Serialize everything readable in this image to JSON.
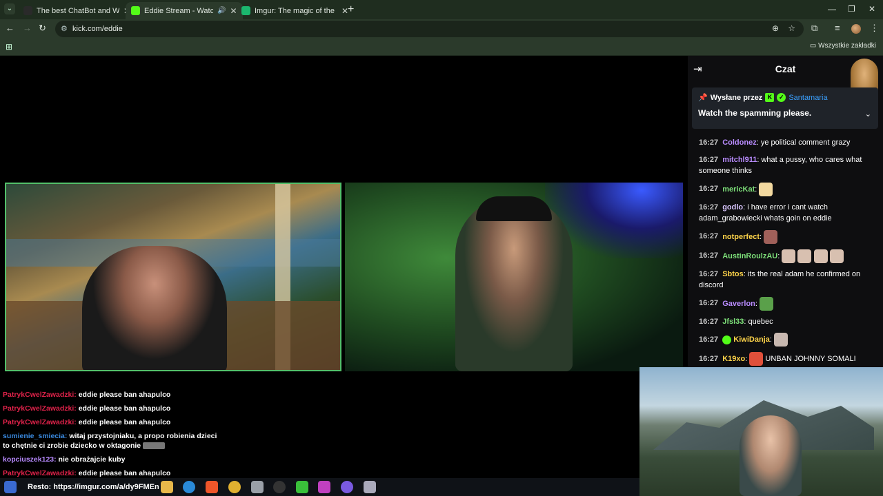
{
  "browser": {
    "tabs": [
      {
        "title": "The best ChatBot and Widgets",
        "active": false
      },
      {
        "title": "Eddie Stream - Watch Live",
        "active": true
      },
      {
        "title": "Imgur: The magic of the Internet",
        "active": false
      }
    ],
    "url": "kick.com/eddie",
    "bookmarks_all": "Wszystkie zakładki"
  },
  "overlay_chat": [
    {
      "user": "PatrykCwelZawadzki:",
      "text": "eddie please ban ahapulco",
      "color": "red"
    },
    {
      "user": "PatrykCwelZawadzki:",
      "text": "eddie please ban ahapulco",
      "color": "red"
    },
    {
      "user": "PatrykCwelZawadzki:",
      "text": "eddie please ban ahapulco",
      "color": "red"
    },
    {
      "user": "sumienie_smiecia:",
      "text": "witaj przystojniaku, a propo robienia dzieci",
      "text2": "to chętnie ci zrobie dziecko w oktagonie",
      "color": "blue"
    },
    {
      "user": "kopciuszek123:",
      "text": "nie obrażajcie kuby",
      "color": "purple"
    },
    {
      "user": "PatrykCwelZawadzki:",
      "text": "eddie please ban ahapulco",
      "color": "red"
    }
  ],
  "chat": {
    "title": "Czat",
    "pinned": {
      "label": "Wysłane przez",
      "user": "Santamaria",
      "text": "Watch the spamming please."
    },
    "messages": [
      {
        "time": "16:27",
        "user": "Coldonez",
        "text": "ye political comment grazy",
        "color": "#b98cff"
      },
      {
        "time": "16:27",
        "user": "mitchl911",
        "text": "what a pussy, who cares what someone thinks",
        "color": "#b98cff"
      },
      {
        "time": "16:27",
        "user": "mericKat",
        "text": "",
        "color": "#7ee07a"
      },
      {
        "time": "16:27",
        "user": "godlo",
        "text": "i have error i cant watch adam_grabowiecki whats goin on eddie",
        "color": "#d9c6ff"
      },
      {
        "time": "16:27",
        "user": "notperfect",
        "text": "",
        "color": "#ffd54a"
      },
      {
        "time": "16:27",
        "user": "AustinRoulzAU",
        "text": "",
        "color": "#7ee07a"
      },
      {
        "time": "16:27",
        "user": "Sbtos",
        "text": "its the real adam he confirmed on discord",
        "color": "#ffd54a"
      },
      {
        "time": "16:27",
        "user": "Gaverlon",
        "text": "",
        "color": "#b98cff"
      },
      {
        "time": "16:27",
        "user": "Jfsl33",
        "text": "quebec",
        "color": "#7ee07a"
      },
      {
        "time": "16:27",
        "user": "KiwiDanja",
        "text": "",
        "color": "#ffd54a"
      },
      {
        "time": "16:27",
        "user": "K19xo",
        "text": "UNBAN JOHNNY SOMALI",
        "color": "#ffd54a"
      }
    ]
  },
  "taskbar": {
    "status": "Resto: https://imgur.com/a/dy9FMEn"
  }
}
